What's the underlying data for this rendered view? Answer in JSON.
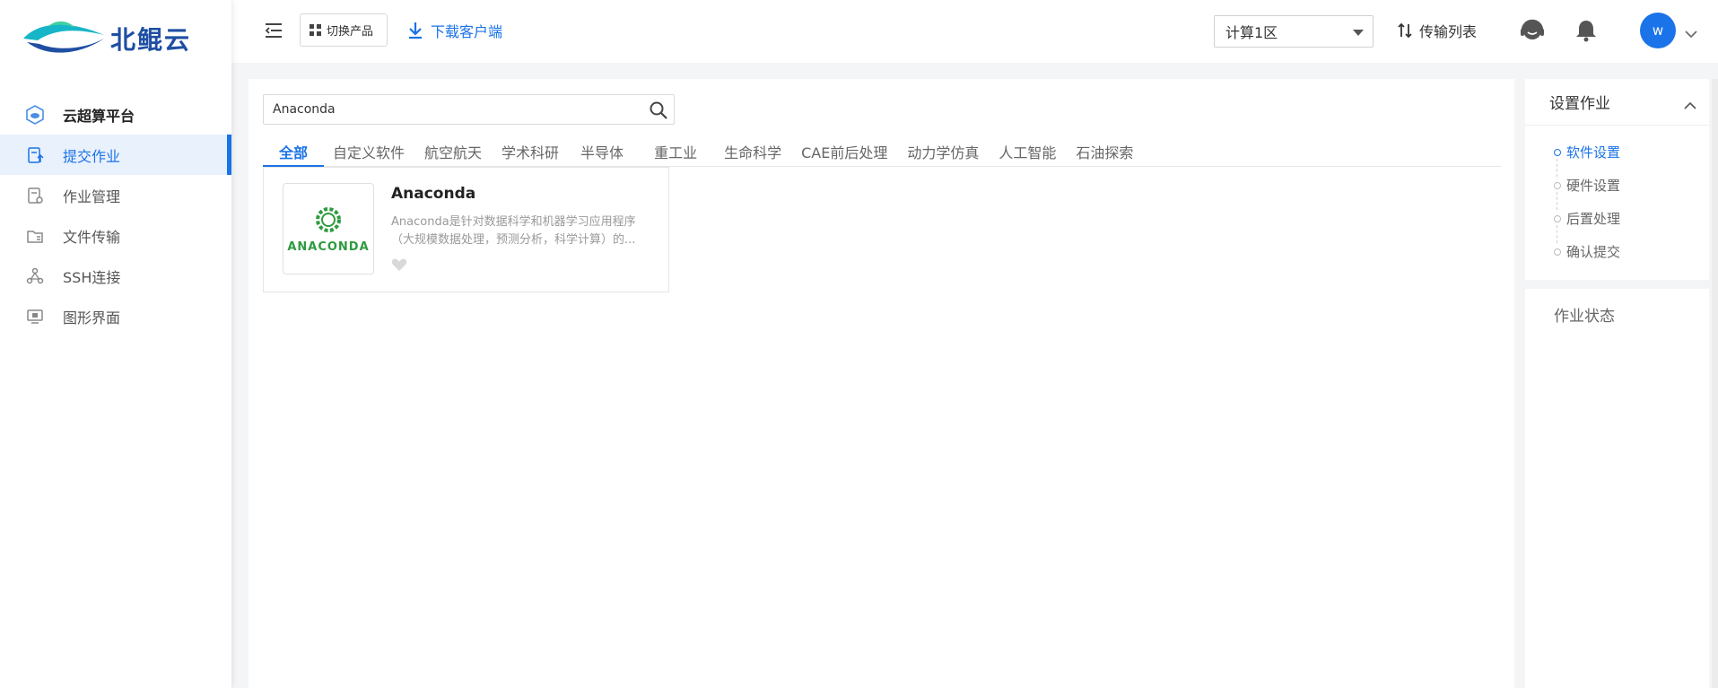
{
  "brand": {
    "name": "北鲲云"
  },
  "sidebar": {
    "items": [
      {
        "label": "云超算平台"
      },
      {
        "label": "提交作业"
      },
      {
        "label": "作业管理"
      },
      {
        "label": "文件传输"
      },
      {
        "label": "SSH连接"
      },
      {
        "label": "图形界面"
      }
    ]
  },
  "topbar": {
    "switch_label": "切换产品",
    "download_label": "下载客户端",
    "zone": "计算1区",
    "transfer_label": "传输列表",
    "avatar_initial": "w"
  },
  "search": {
    "value": "Anaconda"
  },
  "tabs": [
    {
      "label": "全部"
    },
    {
      "label": "自定义软件"
    },
    {
      "label": "航空航天"
    },
    {
      "label": "学术科研"
    },
    {
      "label": "半导体"
    },
    {
      "label": "重工业"
    },
    {
      "label": "生命科学"
    },
    {
      "label": "CAE前后处理"
    },
    {
      "label": "动力学仿真"
    },
    {
      "label": "人工智能"
    },
    {
      "label": "石油探索"
    }
  ],
  "card": {
    "title": "Anaconda",
    "logo_text": "ANACONDA",
    "desc_line1": "Anaconda是针对数据科学和机器学习应用程序",
    "desc_line2": "（大规模数据处理，预测分析，科学计算）的..."
  },
  "settings": {
    "title": "设置作业",
    "steps": [
      {
        "label": "软件设置"
      },
      {
        "label": "硬件设置"
      },
      {
        "label": "后置处理"
      },
      {
        "label": "确认提交"
      }
    ]
  },
  "status": {
    "title": "作业状态"
  },
  "colors": {
    "accent": "#1a73e8",
    "anaconda_green": "#2e9b3f",
    "brand_blue": "#1f4fa3"
  }
}
